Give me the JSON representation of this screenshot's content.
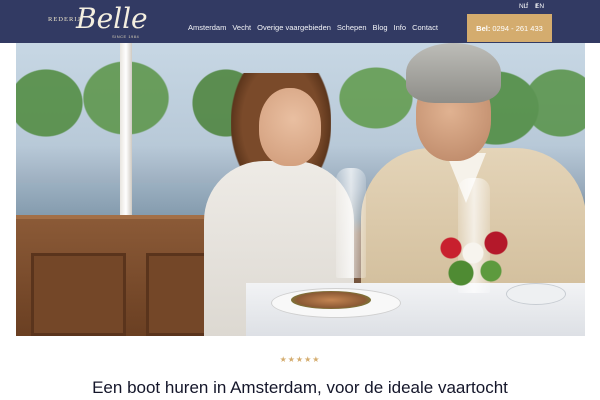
{
  "logo": {
    "rederij": "REDERIJ",
    "name": "Belle",
    "since": "SINCE 1984"
  },
  "social": {
    "facebook": "f",
    "twitter": "t",
    "icons": [
      "facebook-icon",
      "twitter-icon"
    ]
  },
  "languages": {
    "nl": "NL",
    "en": "EN"
  },
  "nav": {
    "items": [
      {
        "label": "Amsterdam"
      },
      {
        "label": "Vecht"
      },
      {
        "label": "Overige vaargebieden"
      },
      {
        "label": "Schepen"
      },
      {
        "label": "Blog"
      },
      {
        "label": "Info"
      },
      {
        "label": "Contact"
      }
    ]
  },
  "phone": {
    "label": "Bel:",
    "number": "0294 - 261 433"
  },
  "rating": {
    "stars": "★★★★★",
    "value": 5,
    "max": 5
  },
  "headline": "Een boot huren in Amsterdam, voor de ideale vaartocht",
  "colors": {
    "header_bg": "#323a63",
    "accent": "#d4ac6e",
    "text": "#14162a"
  }
}
